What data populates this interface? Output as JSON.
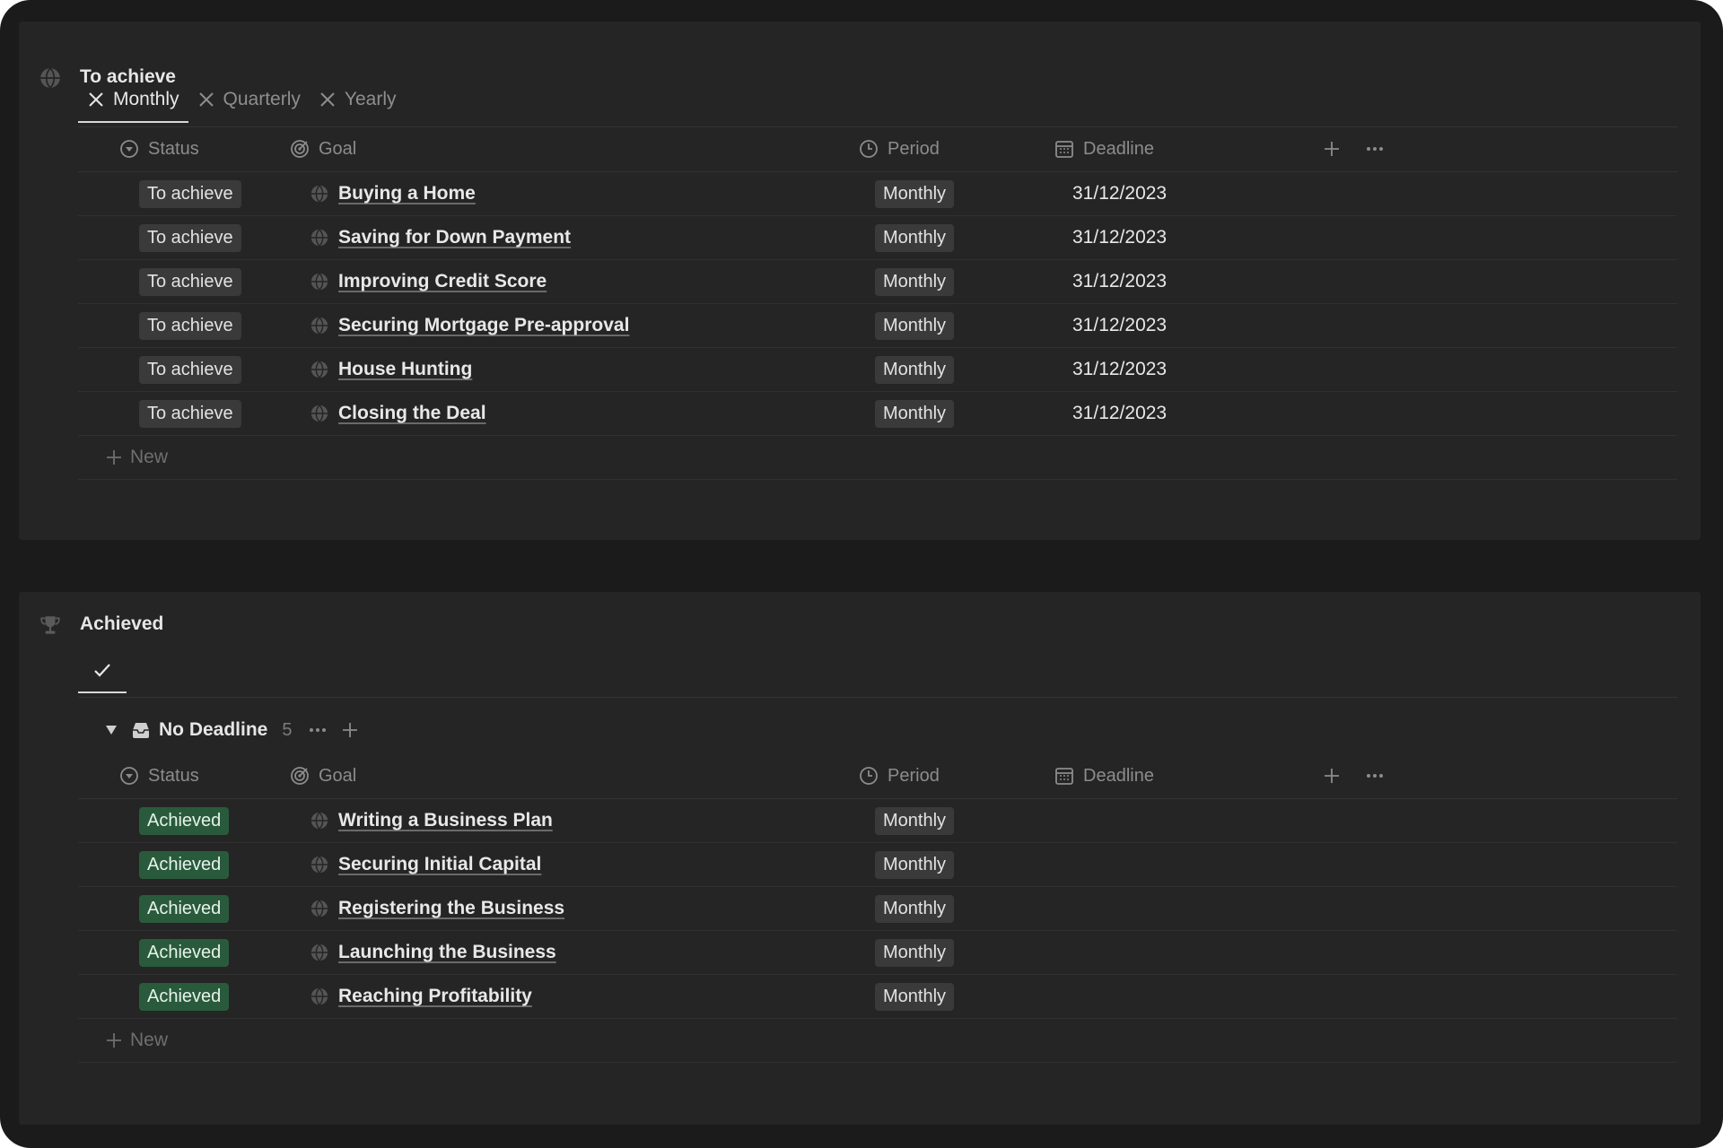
{
  "to_achieve": {
    "title": "To achieve",
    "tabs": [
      {
        "label": "Monthly"
      },
      {
        "label": "Quarterly"
      },
      {
        "label": "Yearly"
      }
    ],
    "columns": {
      "status": "Status",
      "goal": "Goal",
      "period": "Period",
      "deadline": "Deadline"
    },
    "rows": [
      {
        "status": "To achieve",
        "goal": "Buying a Home",
        "period": "Monthly",
        "deadline": "31/12/2023"
      },
      {
        "status": "To achieve",
        "goal": "Saving for Down Payment",
        "period": "Monthly",
        "deadline": "31/12/2023"
      },
      {
        "status": "To achieve",
        "goal": "Improving Credit Score",
        "period": "Monthly",
        "deadline": "31/12/2023"
      },
      {
        "status": "To achieve",
        "goal": "Securing Mortgage Pre-approval",
        "period": "Monthly",
        "deadline": "31/12/2023"
      },
      {
        "status": "To achieve",
        "goal": "House Hunting",
        "period": "Monthly",
        "deadline": "31/12/2023"
      },
      {
        "status": "To achieve",
        "goal": "Closing the Deal",
        "period": "Monthly",
        "deadline": "31/12/2023"
      }
    ],
    "new_label": "New"
  },
  "achieved": {
    "title": "Achieved",
    "group": {
      "name": "No Deadline",
      "count": "5"
    },
    "columns": {
      "status": "Status",
      "goal": "Goal",
      "period": "Period",
      "deadline": "Deadline"
    },
    "rows": [
      {
        "status": "Achieved",
        "goal": "Writing a Business Plan",
        "period": "Monthly"
      },
      {
        "status": "Achieved",
        "goal": "Securing Initial Capital",
        "period": "Monthly"
      },
      {
        "status": "Achieved",
        "goal": "Registering the Business",
        "period": "Monthly"
      },
      {
        "status": "Achieved",
        "goal": "Launching the Business",
        "period": "Monthly"
      },
      {
        "status": "Achieved",
        "goal": "Reaching Profitability",
        "period": "Monthly"
      }
    ],
    "new_label": "New"
  },
  "colors": {
    "background": "#1b1b1b",
    "panel": "#252525",
    "achieved_tag": "#2a5a3c",
    "gray_tag": "#3a3a3a"
  },
  "icons": [
    "globe-icon",
    "trophy-icon",
    "x-icon",
    "check-icon",
    "status-icon",
    "target-icon",
    "clock-icon",
    "calendar-icon",
    "plus-icon",
    "more-icon",
    "inbox-icon",
    "triangle-down-icon"
  ]
}
